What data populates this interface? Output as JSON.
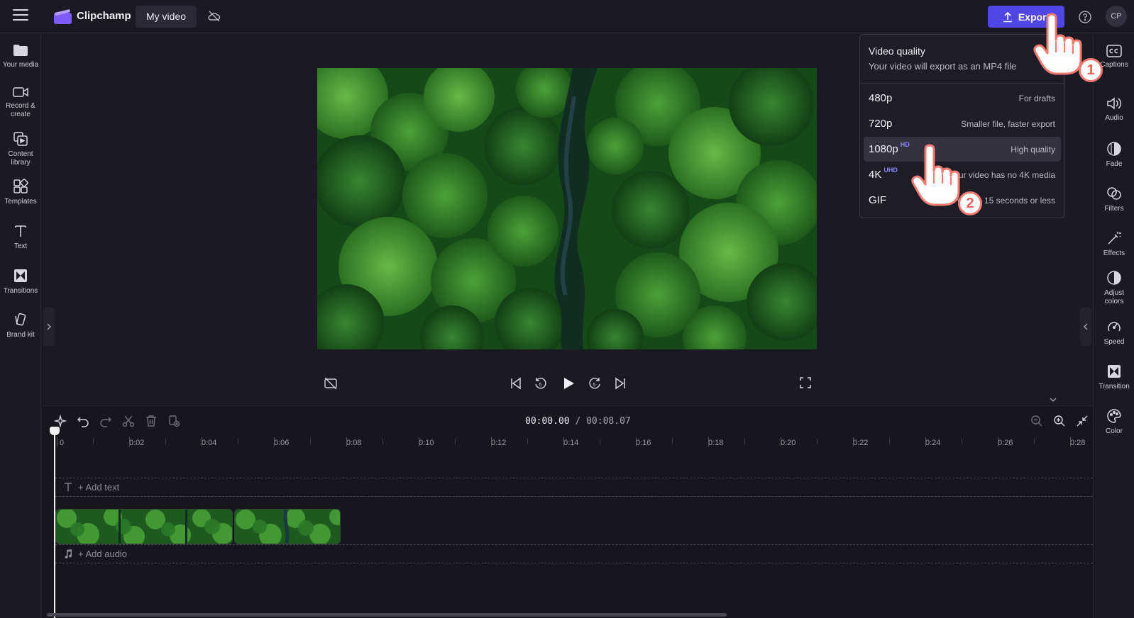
{
  "app": {
    "name": "Clipchamp",
    "project_title": "My video",
    "export_label": "Export",
    "avatar_initials": "CP"
  },
  "left_sidebar": [
    {
      "label": "Your media",
      "icon": "folder-icon"
    },
    {
      "label": "Record &\ncreate",
      "icon": "camera-icon"
    },
    {
      "label": "Content\nlibrary",
      "icon": "library-icon"
    },
    {
      "label": "Templates",
      "icon": "templates-icon"
    },
    {
      "label": "Text",
      "icon": "text-icon"
    },
    {
      "label": "Transitions",
      "icon": "transitions-icon"
    },
    {
      "label": "Brand kit",
      "icon": "brand-kit-icon"
    }
  ],
  "right_sidebar": [
    {
      "label": "Captions",
      "icon": "captions-icon"
    },
    {
      "label": "Audio",
      "icon": "audio-icon"
    },
    {
      "label": "Fade",
      "icon": "fade-icon"
    },
    {
      "label": "Filters",
      "icon": "filters-icon"
    },
    {
      "label": "Effects",
      "icon": "effects-icon"
    },
    {
      "label": "Adjust\ncolors",
      "icon": "adjust-colors-icon"
    },
    {
      "label": "Speed",
      "icon": "speed-icon"
    },
    {
      "label": "Transition",
      "icon": "transition-icon"
    },
    {
      "label": "Color",
      "icon": "color-icon"
    }
  ],
  "export_dropdown": {
    "title": "Video quality",
    "subtitle": "Your video will export as an MP4 file",
    "options": [
      {
        "resolution": "480p",
        "badge": "",
        "description": "For drafts",
        "selected": false
      },
      {
        "resolution": "720p",
        "badge": "",
        "description": "Smaller file, faster export",
        "selected": false
      },
      {
        "resolution": "1080p",
        "badge": "HD",
        "description": "High quality",
        "selected": true
      },
      {
        "resolution": "4K",
        "badge": "UHD",
        "description": "Your video has no 4K media",
        "selected": false
      },
      {
        "resolution": "GIF",
        "badge": "",
        "description": "For videos 15 seconds or less",
        "selected": false
      }
    ]
  },
  "timeline": {
    "current_time": "00:00.00",
    "total_time": "/ 00:08.07",
    "ruler_labels": [
      "0",
      "0:02",
      "0:04",
      "0:06",
      "0:08",
      "0:10",
      "0:12",
      "0:14",
      "0:16",
      "0:18",
      "0:20",
      "0:22",
      "0:24",
      "0:26",
      "0:28"
    ],
    "add_text_label": "+ Add text",
    "add_audio_label": "+ Add audio"
  },
  "tutorial_steps": [
    "1",
    "2"
  ],
  "colors": {
    "accent": "#4f46e5",
    "badge": "#8b86ff",
    "background": "#1b1a22",
    "step_marker": "#f07a72"
  }
}
